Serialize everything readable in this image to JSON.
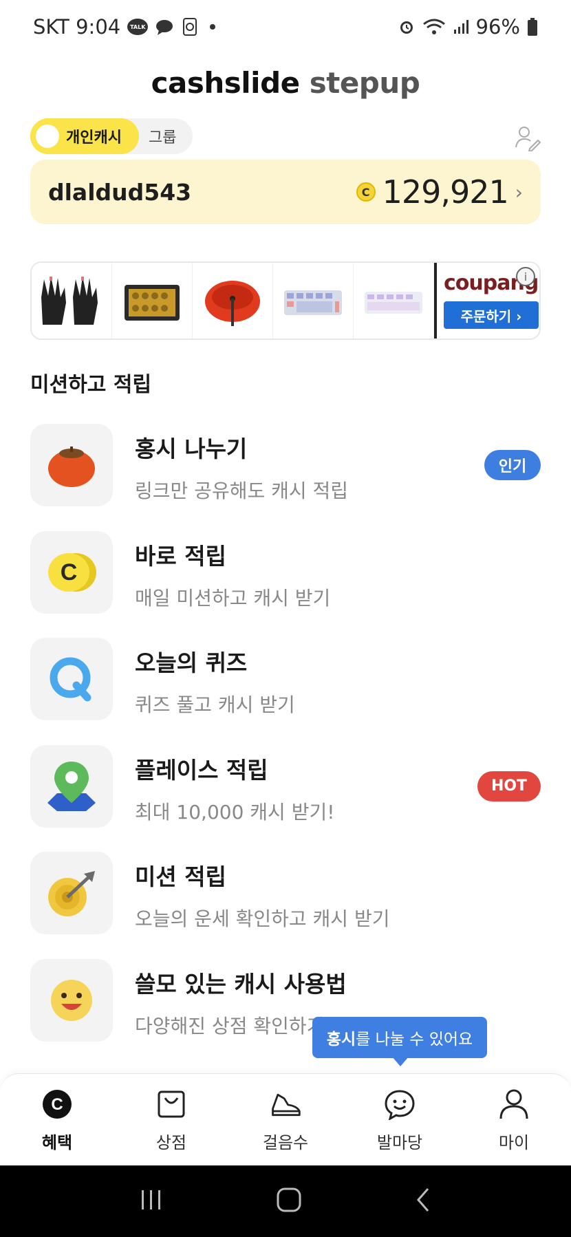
{
  "status_bar": {
    "carrier_time": "SKT 9:04",
    "talk_label": "TALK",
    "battery": "96%"
  },
  "brand": {
    "part1": "cashslide",
    "part2": "stepup"
  },
  "toggle": {
    "active": "개인캐시",
    "other": "그룹"
  },
  "cash": {
    "username": "dlaldud543",
    "coin_symbol": "C",
    "amount": "129,921",
    "chevron": "›"
  },
  "ads": {
    "coupang_logo": "coupang",
    "coupang_button": "주문하기 ›",
    "info": "i",
    "products": [
      "gloves-icon",
      "toolbox-icon",
      "saw-blade-icon",
      "keyboard-icon",
      "keyboard-icon"
    ]
  },
  "section": {
    "title": "미션하고 적립"
  },
  "missions": [
    {
      "title": "홍시 나누기",
      "subtitle": "링크만 공유해도 캐시 적립",
      "badge": "인기",
      "icon": "persimmon-icon"
    },
    {
      "title": "바로 적립",
      "subtitle": "매일 미션하고 캐시 받기",
      "badge": "",
      "icon": "coin-icon"
    },
    {
      "title": "오늘의 퀴즈",
      "subtitle": "퀴즈 풀고 캐시 받기",
      "badge": "",
      "icon": "quiz-q-icon"
    },
    {
      "title": "플레이스 적립",
      "subtitle": "최대 10,000 캐시 받기!",
      "badge": "HOT",
      "icon": "map-pin-icon"
    },
    {
      "title": "미션 적립",
      "subtitle": "오늘의 운세 확인하고 캐시 받기",
      "badge": "",
      "icon": "target-icon"
    },
    {
      "title": "쓸모 있는 캐시 사용법",
      "subtitle": "다양해진 상점 확인하기",
      "badge": "",
      "icon": "smile-icon"
    }
  ],
  "tooltip": {
    "bold": "홍시",
    "rest": "를 나눌 수 있어요"
  },
  "tabs": [
    {
      "label": "혜택",
      "icon": "cash-c-icon",
      "active": true
    },
    {
      "label": "상점",
      "icon": "shopping-bag-icon",
      "active": false
    },
    {
      "label": "걸음수",
      "icon": "sneaker-icon",
      "active": false
    },
    {
      "label": "발마당",
      "icon": "chat-smile-icon",
      "active": false
    },
    {
      "label": "마이",
      "icon": "person-icon",
      "active": false
    }
  ],
  "colors": {
    "accent_yellow": "#fbe34a",
    "card_bg": "#fdf5cf",
    "blue": "#3d7ee0",
    "red": "#e2473f"
  }
}
